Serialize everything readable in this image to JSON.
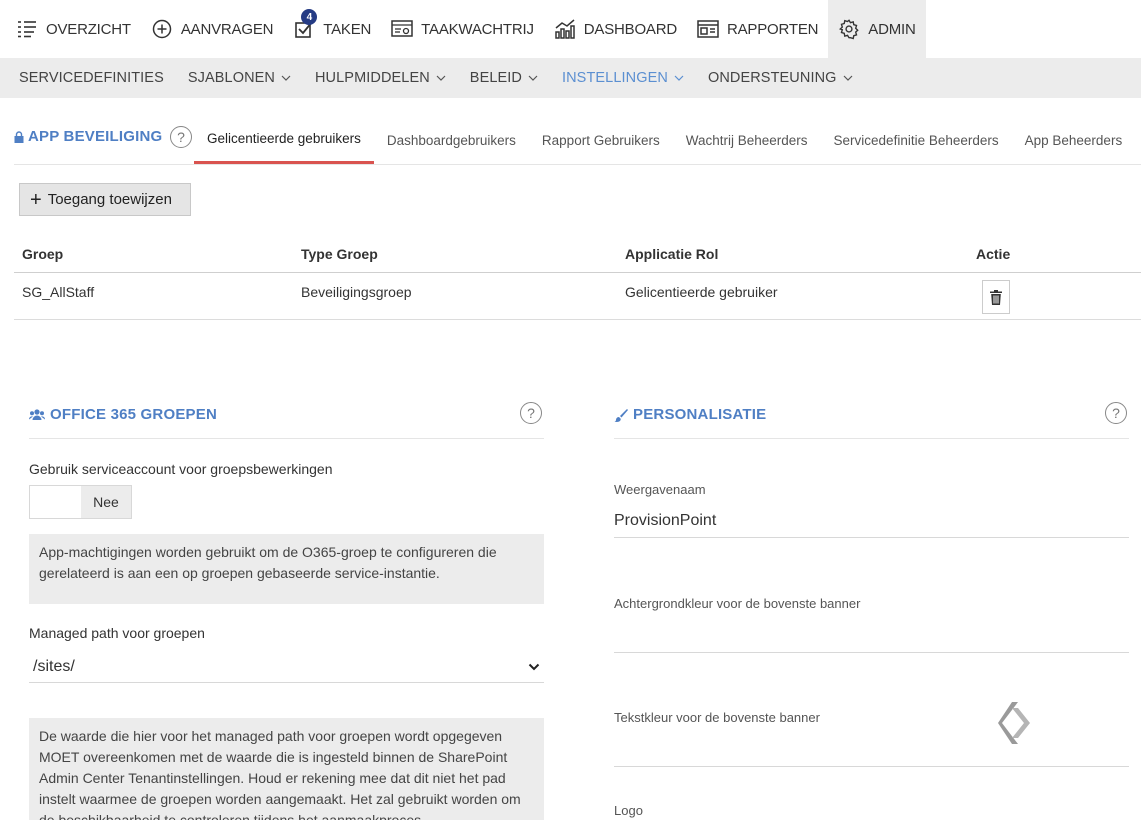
{
  "topnav": {
    "items": [
      {
        "label": "OVERZICHT",
        "icon": "list-icon"
      },
      {
        "label": "AANVRAGEN",
        "icon": "plus-circle-icon"
      },
      {
        "label": "TAKEN",
        "icon": "checkbox-icon",
        "badge": "4"
      },
      {
        "label": "TAAKWACHTRIJ",
        "icon": "queue-icon"
      },
      {
        "label": "DASHBOARD",
        "icon": "chart-icon"
      },
      {
        "label": "RAPPORTEN",
        "icon": "report-icon"
      },
      {
        "label": "ADMIN",
        "icon": "gear-icon",
        "active": true
      }
    ]
  },
  "subnav": {
    "items": [
      {
        "label": "SERVICEDEFINITIES"
      },
      {
        "label": "SJABLONEN",
        "dropdown": true
      },
      {
        "label": "HULPMIDDELEN",
        "dropdown": true
      },
      {
        "label": "BELEID",
        "dropdown": true
      },
      {
        "label": "INSTELLINGEN",
        "dropdown": true,
        "active": true
      },
      {
        "label": "ONDERSTEUNING",
        "dropdown": true
      }
    ]
  },
  "security": {
    "title": "APP BEVEILIGING",
    "help": "?",
    "tabs": [
      {
        "label": "Gelicentieerde gebruikers",
        "active": true
      },
      {
        "label": "Dashboardgebruikers"
      },
      {
        "label": "Rapport Gebruikers"
      },
      {
        "label": "Wachtrij Beheerders"
      },
      {
        "label": "Servicedefinitie Beheerders"
      },
      {
        "label": "App Beheerders"
      }
    ],
    "assign_button": "Toegang toewijzen",
    "table": {
      "headers": [
        "Groep",
        "Type Groep",
        "Applicatie Rol",
        "Actie"
      ],
      "rows": [
        [
          "SG_AllStaff",
          "Beveiligingsgroep",
          "Gelicentieerde gebruiker"
        ]
      ]
    }
  },
  "o365": {
    "title": "OFFICE 365 GROEPEN",
    "help": "?",
    "service_account_label": "Gebruik serviceaccount voor groepsbewerkingen",
    "toggle_value": "Nee",
    "info1": "App-machtigingen worden gebruikt om de O365-groep te configureren die gerelateerd is aan een op groepen gebaseerde service-instantie.",
    "managed_path_label": "Managed path voor groepen",
    "managed_path_value": "/sites/",
    "info2": "De waarde die hier voor het managed path voor groepen wordt opgegeven MOET overeenkomen met de waarde die is ingesteld binnen de SharePoint Admin Center Tenantinstellingen. Houd er rekening mee dat dit niet het pad instelt waarmee de groepen worden aangemaakt. Het zal gebruikt worden om de beschikbaarheid te controleren tijdens het aanmaakproces."
  },
  "personalization": {
    "title": "PERSONALISATIE",
    "help": "?",
    "display_name_label": "Weergavenaam",
    "display_name_value": "ProvisionPoint",
    "banner_bg_label": "Achtergrondkleur voor de bovenste banner",
    "banner_text_label": "Tekstkleur voor de bovenste banner",
    "logo_label": "Logo"
  },
  "colors": {
    "accent": "#4f7fc4",
    "active_tab_underline": "#d9534f",
    "badge": "#253b84",
    "panel_bg": "#ececec"
  }
}
